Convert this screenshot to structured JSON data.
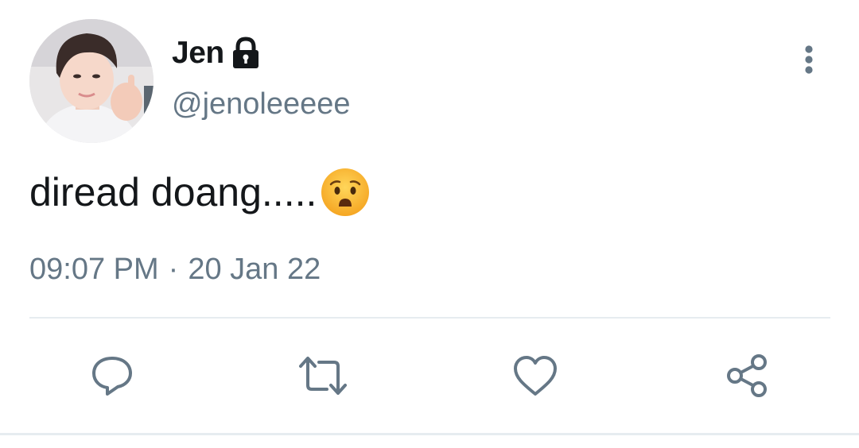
{
  "tweet": {
    "author": {
      "display_name": "Jen",
      "handle": "@jenoleeeee",
      "protected_icon": "lock-icon",
      "avatar": "profile-photo"
    },
    "text": "diread doang.....",
    "emoji": "anguished-face",
    "timestamp": {
      "time": "09:07 PM",
      "separator": "·",
      "date": "20 Jan 22"
    },
    "menu_icon": "more-vertical-icon",
    "actions": [
      {
        "name": "reply",
        "icon": "reply-icon"
      },
      {
        "name": "retweet",
        "icon": "retweet-icon"
      },
      {
        "name": "like",
        "icon": "heart-icon"
      },
      {
        "name": "share",
        "icon": "share-icon"
      }
    ]
  },
  "colors": {
    "text_primary": "#14171a",
    "text_secondary": "#657786",
    "divider": "#e6ecf0",
    "icon": "#657786"
  }
}
